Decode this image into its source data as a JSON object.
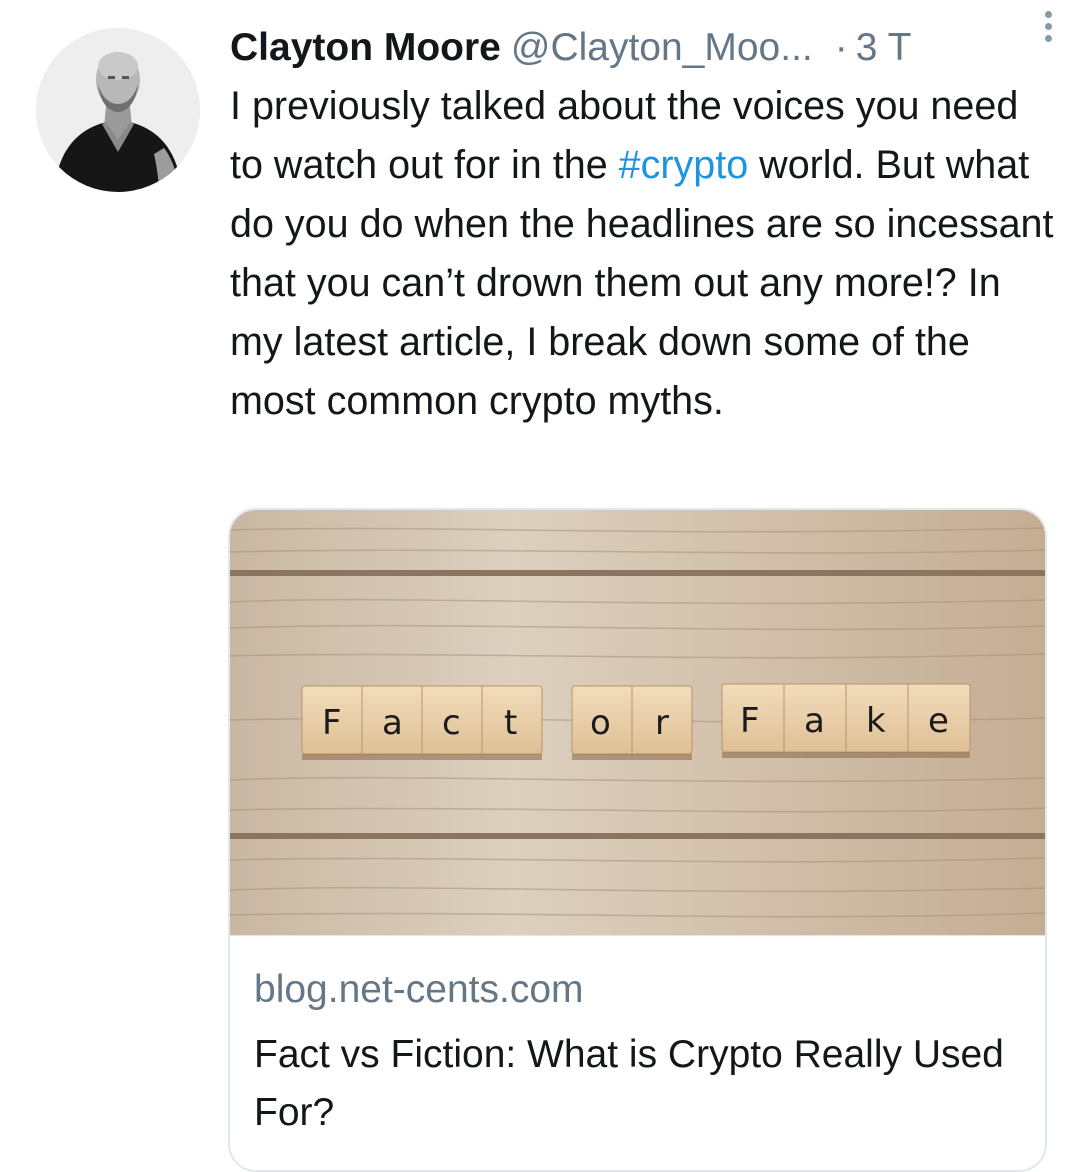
{
  "tweet": {
    "author_name": "Clayton Moore",
    "author_handle": "@Clayton_Moo...",
    "separator": "·",
    "timestamp": "3 T",
    "more_icon": "more-vertical-icon",
    "text_before_hashtag": "I previously talked about the voices you need to watch out for in the ",
    "hashtag": "#crypto",
    "text_after_hashtag": " world. But what do you do when the headlines are so incessant that you can’t drown them out any more!?  In my latest article, I break down some of the most common crypto myths."
  },
  "card": {
    "image_tiles_left": [
      "F",
      "a",
      "c",
      "t"
    ],
    "image_tiles_middle": [
      "o",
      "r"
    ],
    "image_tiles_right": [
      "F",
      "a",
      "k",
      "e"
    ],
    "domain": "blog.net-cents.com",
    "title": "Fact vs Fiction: What is Crypto Really Used For?"
  },
  "colors": {
    "link": "#1b95e0",
    "secondary_text": "#657786",
    "border": "#e1e8ed"
  }
}
